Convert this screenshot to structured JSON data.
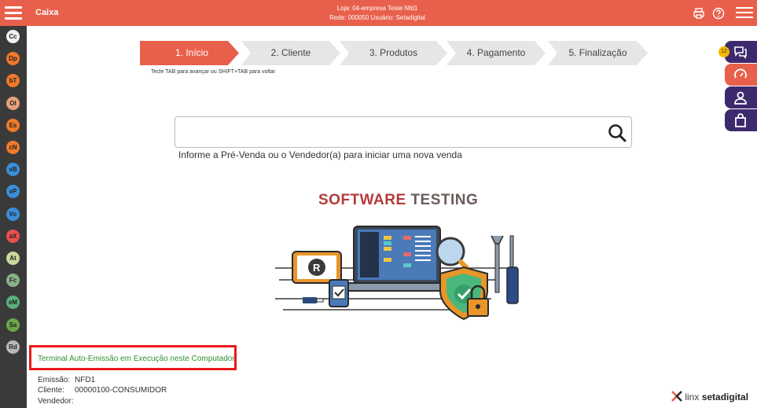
{
  "header": {
    "app_title": "Caixa",
    "store_line": "Loja: 04-empresa Teste Nfd1",
    "network_line": "Rede: 000050 Usuário: Setadigital",
    "bg_color": "#e8604c"
  },
  "dock": {
    "items": [
      {
        "label": "Cc",
        "color": "#f2f2f2"
      },
      {
        "label": "Dp",
        "color": "#f07a2a"
      },
      {
        "label": "bT",
        "color": "#f07a2a"
      },
      {
        "label": "Ol",
        "color": "#e8a07a"
      },
      {
        "label": "Es",
        "color": "#f07a2a"
      },
      {
        "label": "cN",
        "color": "#f07a2a"
      },
      {
        "label": "vB",
        "color": "#3a8fd9"
      },
      {
        "label": "vP",
        "color": "#3a8fd9"
      },
      {
        "label": "Vc",
        "color": "#3a8fd9"
      },
      {
        "label": "aX",
        "color": "#e85050"
      },
      {
        "label": "At",
        "color": "#c8d8a0"
      },
      {
        "label": "Fc",
        "color": "#8ab08a"
      },
      {
        "label": "eM",
        "color": "#5ab07a"
      },
      {
        "label": "Sa",
        "color": "#6aa84a"
      },
      {
        "label": "Rd",
        "color": "#b8b8b8"
      }
    ]
  },
  "stepper": {
    "steps": [
      {
        "label": "1. Início",
        "active": true
      },
      {
        "label": "2. Cliente",
        "active": false
      },
      {
        "label": "3. Produtos",
        "active": false
      },
      {
        "label": "4. Pagamento",
        "active": false
      },
      {
        "label": "5. Finalização",
        "active": false
      }
    ],
    "hint": "Tecle TAB para avançar ou SHIFT+TAB para voltar",
    "active_color": "#e8604c",
    "inactive_color": "#e6e6e6"
  },
  "search": {
    "value": "",
    "placeholder": "",
    "help_text": "Informe a Pré-Venda ou o Vendedor(a) para iniciar uma nova venda"
  },
  "illustration": {
    "title_part1": "SOFTWARE",
    "title_part2": "TESTING"
  },
  "status": {
    "auto_emission": "Terminal Auto-Emissão em Execução neste Computador",
    "emission_label": "Emissão:",
    "emission_value": "NFD1",
    "client_label": "Cliente:",
    "client_value": "00000100-CONSUMIDOR",
    "seller_label": "Vendedor:",
    "seller_value": ""
  },
  "side": {
    "badge_count": "12",
    "colors": [
      "#3d2a6e",
      "#e8604c",
      "#3d2a6e",
      "#3d2a6e"
    ]
  },
  "brand": {
    "prefix": "linx",
    "name": "setadigital"
  }
}
